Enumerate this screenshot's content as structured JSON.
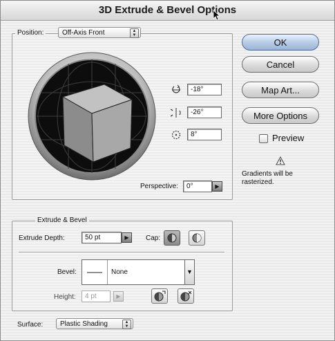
{
  "dialog": {
    "title": "3D Extrude & Bevel Options"
  },
  "position": {
    "label": "Position:",
    "selected": "Off-Axis Front",
    "rotation_x": "-18°",
    "rotation_y": "-26°",
    "rotation_z": "8°",
    "perspective_label": "Perspective:",
    "perspective_value": "0°"
  },
  "buttons": {
    "ok": "OK",
    "cancel": "Cancel",
    "map_art": "Map Art...",
    "more_options": "More Options"
  },
  "preview": {
    "label": "Preview",
    "checked": false
  },
  "warning": {
    "text_line1": "Gradients will be",
    "text_line2": "rasterized."
  },
  "extrude": {
    "group_label": "Extrude & Bevel",
    "depth_label": "Extrude Depth:",
    "depth_value": "50 pt",
    "cap_label": "Cap:",
    "bevel_label": "Bevel:",
    "bevel_value": "None",
    "height_label": "Height:",
    "height_value": "4 pt"
  },
  "surface": {
    "label": "Surface:",
    "selected": "Plastic Shading"
  },
  "colors": {
    "default_button": "#a9c1e0",
    "cube_face": "#9e9e9e",
    "track_ring": "#000000"
  }
}
